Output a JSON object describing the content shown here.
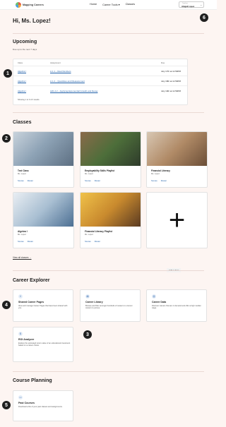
{
  "header": {
    "brand": "Mapping Careers",
    "nav": [
      "Home",
      "Career Tools ▾",
      "Classes"
    ],
    "account_label": "Teacher",
    "account_name": "Abigail Lopez"
  },
  "badges": [
    "1",
    "2",
    "3",
    "4",
    "5",
    "6"
  ],
  "greeting": "Hi, Ms. Lopez!",
  "upcoming": {
    "title": "Upcoming",
    "subtitle": "Due up to the next 7 days",
    "headers": [
      "Class",
      "Assignment",
      "Due"
    ],
    "rows": [
      {
        "class": "Algebra I",
        "assignment": "A.1.1 – Real Numbers",
        "due": "July 17th at 11:59PM"
      },
      {
        "class": "Algebra I",
        "assignment": "A.1.2 – Quantities and Measurement",
        "due": "July 18th at 11:59PM"
      },
      {
        "class": "Algebra I",
        "assignment": "A2b-4.2 – Applying Exponential Growth and Decay",
        "due": "July 19th at 11:59PM"
      }
    ],
    "footer": "Showing 1 to 3 of 3 results"
  },
  "classes": {
    "title": "Classes",
    "cards": [
      {
        "title": "Test Class",
        "owner": "Ms. Lopez",
        "scores": "Scores",
        "roster": "Roster"
      },
      {
        "title": "Employability Skills Playlist",
        "owner": "Ms. Lopez",
        "scores": "Scores",
        "roster": "Roster"
      },
      {
        "title": "Financial Literacy",
        "owner": "Ms. Lopez",
        "scores": "Scores",
        "roster": "Roster"
      },
      {
        "title": "Algebra I",
        "owner": "Ms. Lopez",
        "scores": "Scores",
        "roster": "Roster"
      },
      {
        "title": "Financial Literacy Playlist",
        "owner": "Ms. Lopez",
        "scores": "Scores",
        "roster": "Roster"
      }
    ],
    "add_label": "Add a class",
    "view_all": "View all classes →"
  },
  "explorer": {
    "title": "Career Explorer",
    "tools": [
      {
        "title": "Shared Career Pages",
        "desc": "View and manage Career Pages that have been shared with you."
      },
      {
        "title": "Career Library",
        "desc": "Browse and filter amongst hundreds of careers to uncover careers to pursue."
      },
      {
        "title": "Career Data",
        "desc": "Discover careers that are in demand and offer a high median wage."
      },
      {
        "title": "ROI Analyzer",
        "desc": "Explore the estimated return value of an educational investment based on a career choice."
      }
    ]
  },
  "planning": {
    "title": "Course Planning",
    "tools": [
      {
        "title": "Past Courses",
        "desc": "Download a file of your past classes and assignments."
      }
    ]
  },
  "colors": {
    "link": "#1f5fa8",
    "background": "#fdf5f2",
    "badge": "#1f1f1f"
  }
}
